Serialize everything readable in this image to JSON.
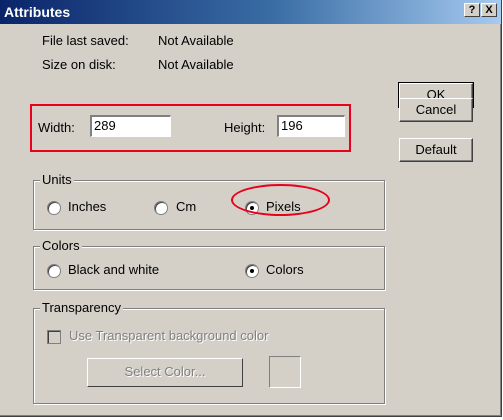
{
  "window": {
    "title": "Attributes",
    "help_label": "?",
    "close_label": "X"
  },
  "info": {
    "file_saved_label": "File last saved:",
    "file_saved_value": "Not Available",
    "size_label": "Size on disk:",
    "size_value": "Not Available"
  },
  "dimensions": {
    "width_label": "Width:",
    "width_value": "289",
    "height_label": "Height:",
    "height_value": "196"
  },
  "buttons": {
    "ok": "OK",
    "cancel": "Cancel",
    "default": "Default"
  },
  "units": {
    "title": "Units",
    "options": [
      "Inches",
      "Cm",
      "Pixels"
    ],
    "selected": "Pixels"
  },
  "colors": {
    "title": "Colors",
    "options": [
      "Black and white",
      "Colors"
    ],
    "selected": "Colors"
  },
  "transparency": {
    "title": "Transparency",
    "checkbox_label": "Use Transparent background color",
    "select_color_label": "Select Color..."
  },
  "annotation_color": "#e8001c"
}
